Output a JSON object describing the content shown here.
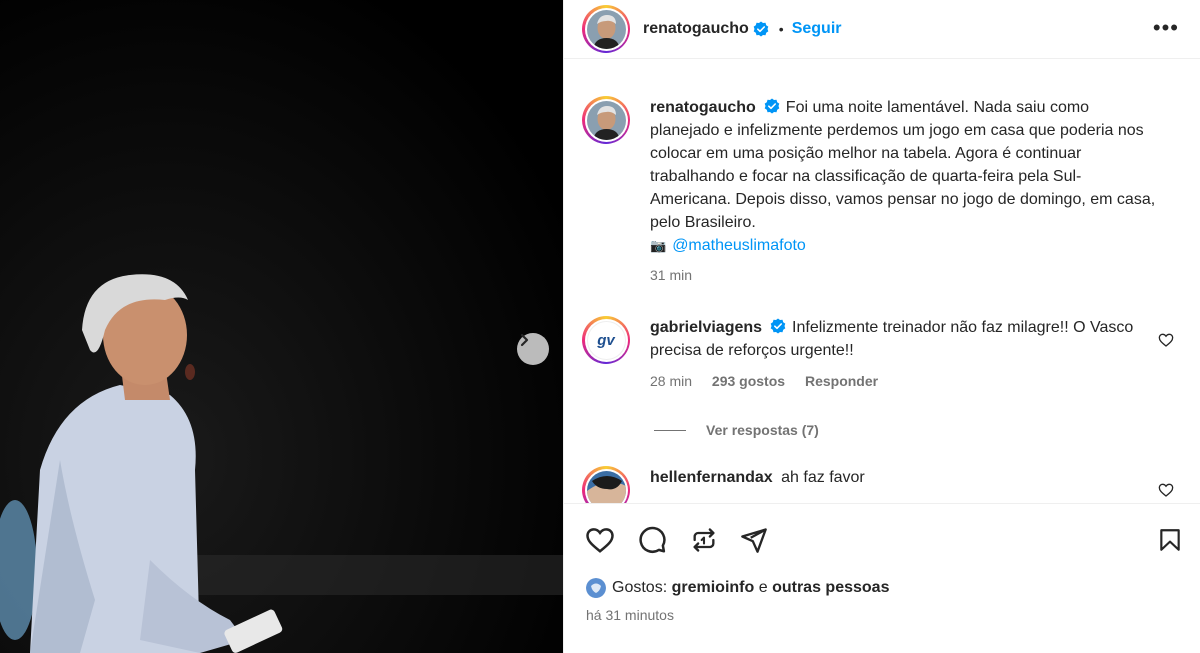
{
  "post": {
    "author": "renatogaucho",
    "follow_label": "Seguir",
    "dot": "•",
    "more_label": "•••",
    "caption": {
      "author": "renatogaucho",
      "text": "Foi uma noite lamentável. Nada saiu como planejado e infelizmente perdemos um jogo em casa que poderia nos colocar em uma posição melhor na tabela. Agora é continuar trabalhando e focar na classificação de quarta-feira pela Sul-Americana. Depois disso, vamos pensar no jogo de domingo, em casa, pelo Brasileiro.",
      "camera_emoji": "📷",
      "mention": "@matheuslimafoto",
      "time": "31 min"
    }
  },
  "comments": [
    {
      "author": "gabrielviagens",
      "text": "Infelizmente treinador não faz milagre!! O Vasco precisa de reforços urgente!!",
      "time": "28 min",
      "likes": "293 gostos",
      "reply_label": "Responder",
      "view_replies": "Ver respostas (7)",
      "avatar_text": "gv"
    },
    {
      "author": "hellenfernandax",
      "text": "ah faz favor"
    }
  ],
  "footer": {
    "likes_prefix": "Gostos:",
    "likes_user": "gremioinfo",
    "likes_and": "e",
    "likes_others": "outras pessoas",
    "time_ago": "há 31 minutos"
  },
  "colors": {
    "accent": "#0095f6",
    "text": "#262626",
    "muted": "#737373",
    "verified": "#0095f6"
  },
  "icons": [
    "next-arrow-icon",
    "verified-icon",
    "more-icon",
    "heart-icon",
    "comment-icon",
    "repost-icon",
    "share-icon",
    "bookmark-icon",
    "camera-icon"
  ]
}
